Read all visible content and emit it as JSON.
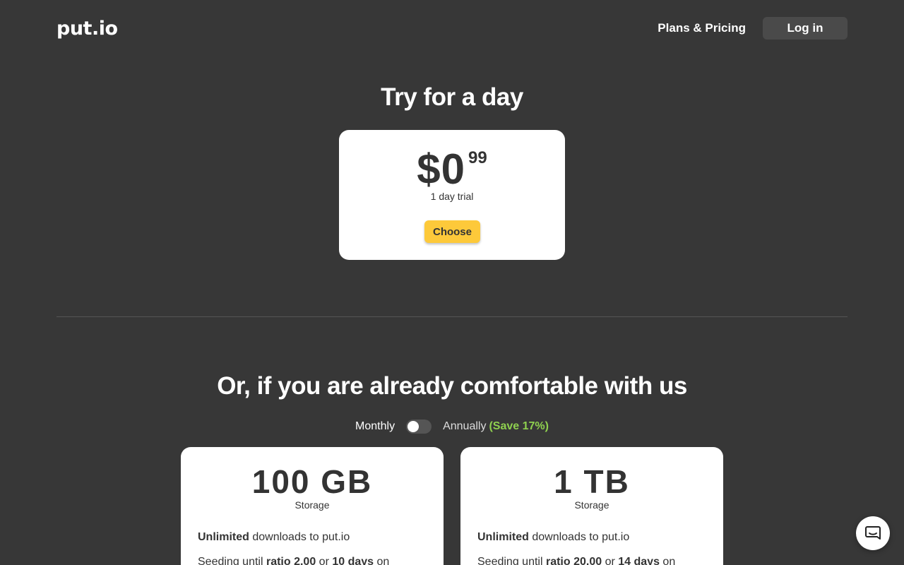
{
  "header": {
    "logo": "put.io",
    "nav_pricing": "Plans & Pricing",
    "login": "Log in"
  },
  "trial": {
    "title": "Try for a day",
    "price_main": "$0",
    "price_cents": "99",
    "subtitle": "1 day trial",
    "choose": "Choose"
  },
  "plans": {
    "title": "Or, if you are already comfortable with us",
    "billing": {
      "monthly": "Monthly",
      "annually": "Annually",
      "save": "(Save 17%)",
      "annual_selected": false
    },
    "items": [
      {
        "size": "100 GB",
        "storage": "Storage",
        "unlimited": "Unlimited",
        "downloads": " downloads to put.io",
        "seeding_prefix": "Seeding until ",
        "ratio": "ratio 2.00",
        "or": " or ",
        "days": "10 days",
        "suffix": " on"
      },
      {
        "size": "1 TB",
        "storage": "Storage",
        "unlimited": "Unlimited",
        "downloads": " downloads to put.io",
        "seeding_prefix": "Seeding until ",
        "ratio": "ratio 20.00",
        "or": " or ",
        "days": "14 days",
        "suffix": " on"
      }
    ]
  },
  "colors": {
    "background": "#373737",
    "accent": "#fdc93a",
    "save_green": "#8fd14f"
  },
  "icons": {
    "chat": "chat-bubble-icon"
  }
}
